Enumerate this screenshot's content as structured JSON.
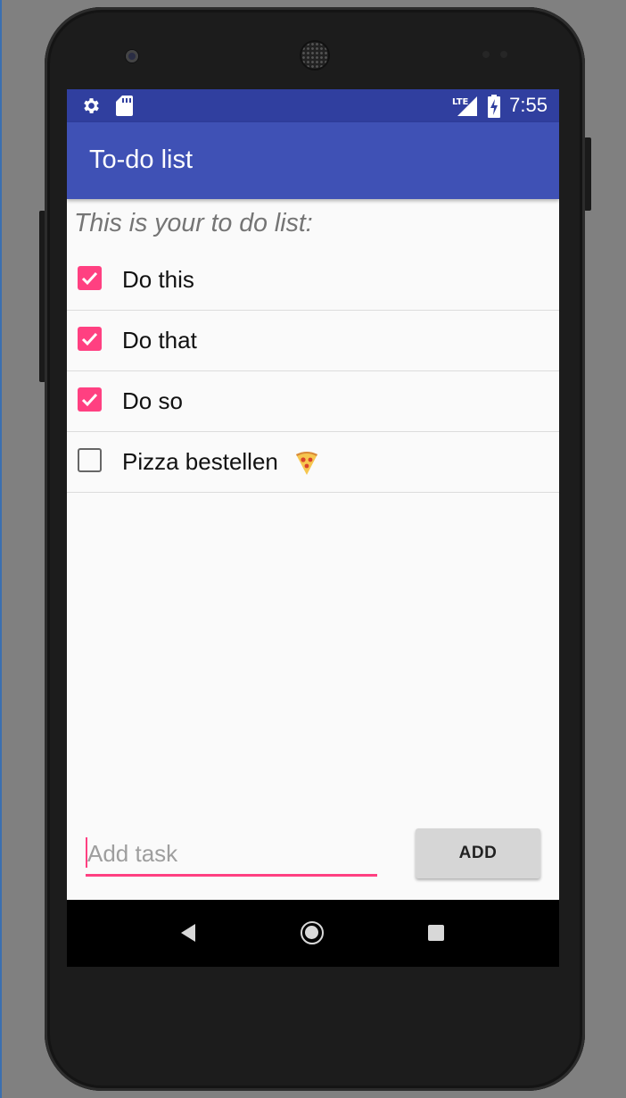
{
  "status_bar": {
    "time": "7:55",
    "network_label": "LTE",
    "icons": [
      "settings-gear-icon",
      "sd-card-icon",
      "lte-signal-icon",
      "battery-charging-icon"
    ]
  },
  "app_bar": {
    "title": "To-do list"
  },
  "main": {
    "heading": "This is your to do list:",
    "tasks": [
      {
        "label": "Do this",
        "checked": true
      },
      {
        "label": "Do that",
        "checked": true
      },
      {
        "label": "Do so",
        "checked": true
      },
      {
        "label": "Pizza bestellen",
        "checked": false,
        "emoji": "pizza-icon"
      }
    ]
  },
  "add_form": {
    "placeholder": "Add task",
    "value": "",
    "button_label": "ADD"
  },
  "nav_bar": {
    "icons": [
      "back-icon",
      "home-icon",
      "recents-icon"
    ]
  },
  "colors": {
    "status_bar": "#303f9f",
    "app_bar": "#3f51b5",
    "accent": "#ff4081",
    "background": "#fafafa"
  }
}
